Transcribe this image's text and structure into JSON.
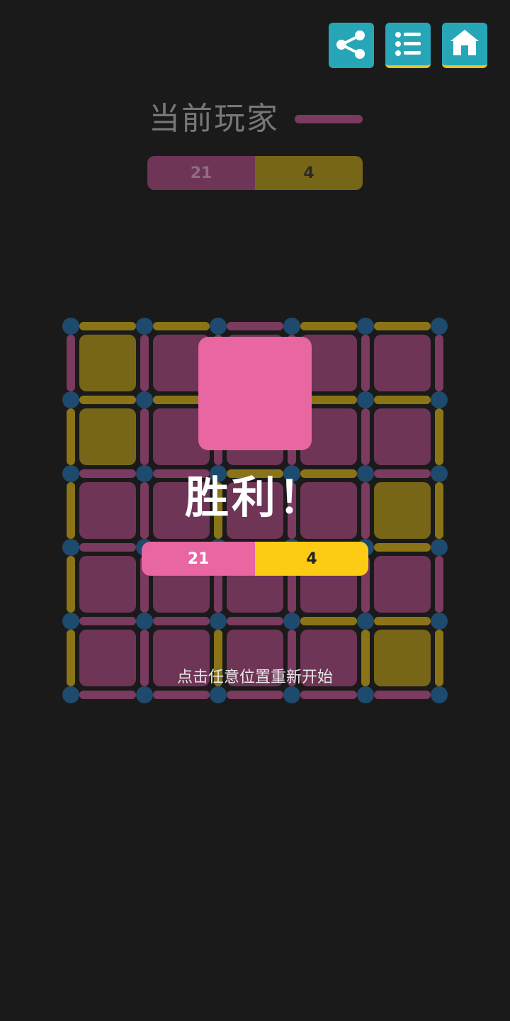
{
  "toolbar": {
    "buttons": [
      {
        "name": "share-button",
        "icon": "share-icon"
      },
      {
        "name": "menu-list-button",
        "icon": "list-icon"
      },
      {
        "name": "home-button",
        "icon": "home-icon"
      }
    ]
  },
  "current_player": {
    "label": "当前玩家",
    "indicator_color": "#7b3a5f"
  },
  "top_score": {
    "player1": "21",
    "player2": "4",
    "player1_color": "#6e3556",
    "player2_color": "#776617"
  },
  "board": {
    "size": 5,
    "cells": [
      [
        "p2",
        "p1",
        "p1",
        "p1",
        "p1"
      ],
      [
        "p2",
        "p1",
        "p1",
        "p1",
        "p1"
      ],
      [
        "p1",
        "p1",
        "p1",
        "p1",
        "p2"
      ],
      [
        "p1",
        "p1",
        "p1",
        "p1",
        "p1"
      ],
      [
        "p1",
        "p1",
        "p1",
        "p1",
        "p2"
      ]
    ],
    "h_lines": [
      [
        "p2",
        "p2",
        "p1",
        "p2",
        "p2"
      ],
      [
        "p2",
        "p2",
        "p2",
        "p2",
        "p2"
      ],
      [
        "p1",
        "p1",
        "p2",
        "p2",
        "p1"
      ],
      [
        "p1",
        "p1",
        "p1",
        "p1",
        "p2"
      ],
      [
        "p1",
        "p1",
        "p1",
        "p2",
        "p2"
      ],
      [
        "p1",
        "p1",
        "p1",
        "p1",
        "p1"
      ]
    ],
    "v_lines": [
      [
        "p1",
        "p1",
        "p1",
        "p1",
        "p1",
        "p1"
      ],
      [
        "p2",
        "p1",
        "p1",
        "p1",
        "p1",
        "p2"
      ],
      [
        "p2",
        "p1",
        "p2",
        "p1",
        "p1",
        "p2"
      ],
      [
        "p2",
        "p1",
        "p1",
        "p1",
        "p1",
        "p1"
      ],
      [
        "p2",
        "p1",
        "p2",
        "p1",
        "p2",
        "p2"
      ]
    ],
    "colors": {
      "p1_cell": "#6e3556",
      "p2_cell": "#776617",
      "p1_line": "#7b3a5f",
      "p2_line": "#8a7417",
      "dot": "#1e4a6e"
    }
  },
  "result": {
    "winner_color": "#e866a1",
    "title": "胜利！",
    "player1_score": "21",
    "player2_score": "4",
    "player1_color": "#e866a1",
    "player2_color": "#fccc14",
    "restart_hint": "点击任意位置重新开始"
  }
}
